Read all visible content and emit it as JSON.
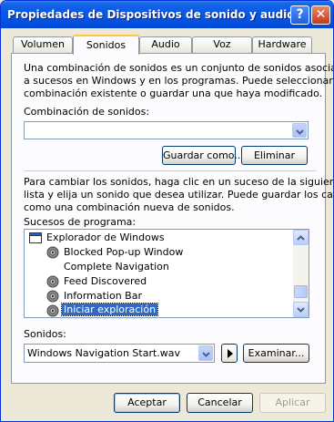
{
  "window": {
    "title": "Propiedades de Dispositivos de sonido y audio",
    "help_glyph": "?",
    "close_glyph": "✕"
  },
  "tabs": [
    {
      "label": "Volumen",
      "active": false
    },
    {
      "label": "Sonidos",
      "active": true
    },
    {
      "label": "Audio",
      "active": false
    },
    {
      "label": "Voz",
      "active": false
    },
    {
      "label": "Hardware",
      "active": false
    }
  ],
  "sonidos": {
    "intro_lines": [
      "Una combinación de sonidos es un conjunto de sonidos asociados",
      "a sucesos en Windows y en los programas. Puede seleccionar una",
      "combinación existente o guardar una que haya modificado."
    ],
    "scheme_label": "Combinación de sonidos:",
    "scheme_value": "",
    "save_as_label": "Guardar como...",
    "delete_label": "Eliminar",
    "change_lines": [
      "Para cambiar los sonidos, haga clic en un suceso de la siguiente",
      "lista y elija un sonido que desea utilizar. Puede guardar los cambios",
      "como una combinación nueva de sonidos."
    ],
    "events_label": "Sucesos de programa:",
    "events": [
      {
        "label": "Explorador de Windows",
        "icon": "window-icon",
        "selected": false
      },
      {
        "label": "Blocked Pop-up Window",
        "icon": "speaker-icon",
        "selected": false
      },
      {
        "label": "Complete Navigation",
        "icon": "",
        "selected": false
      },
      {
        "label": "Feed Discovered",
        "icon": "speaker-icon",
        "selected": false
      },
      {
        "label": "Information Bar",
        "icon": "speaker-icon",
        "selected": false
      },
      {
        "label": "Iniciar exploración",
        "icon": "speaker-icon",
        "selected": true
      }
    ],
    "sounds_label": "Sonidos:",
    "sound_value": "Windows Navigation Start.wav",
    "browse_label": "Examinar..."
  },
  "buttons": {
    "accept": "Aceptar",
    "cancel": "Cancelar",
    "apply": "Aplicar"
  },
  "colors": {
    "titlebar": "#0553E2",
    "selection": "#316AC5",
    "dialog_bg": "#ECE9D8"
  }
}
